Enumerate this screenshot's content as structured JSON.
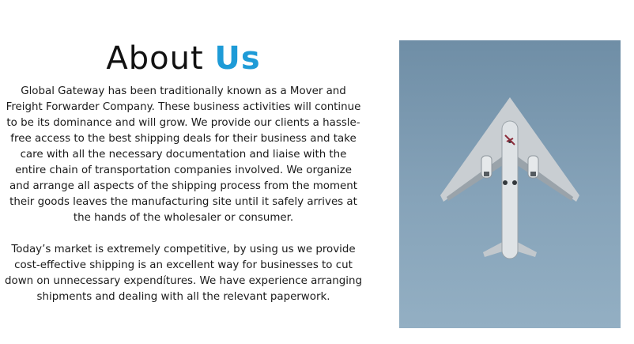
{
  "about": {
    "heading_main": "About ",
    "heading_accent": "Us",
    "paragraph_1": "Global Gateway has been traditionally known as a Mover and Freight Forwarder Company. These business activities will continue to be its dominance and will grow. We provide our clients a hassle-free access to the best shipping deals for their business and take care with all the necessary documentation and liaise with the entire chain of transportation companies involved. We organize and arrange all aspects of the shipping process from the moment their goods leaves the manufacturing site until it safely arrives at the hands of the wholesaler or consumer.",
    "paragraph_2": "Today’s market is extremely competitive, by using us we provide cost-effective shipping is an excellent way for businesses to cut down on unnecessary expendítures. We have experience arranging shipments and dealing with all the relevant paperwork."
  },
  "image": {
    "subject": "airplane-from-below",
    "sky_color": "#7f9db4",
    "plane_color": "#d9dde0"
  },
  "colors": {
    "accent": "#1e9bd7",
    "text": "#111111",
    "background": "#ffffff"
  }
}
